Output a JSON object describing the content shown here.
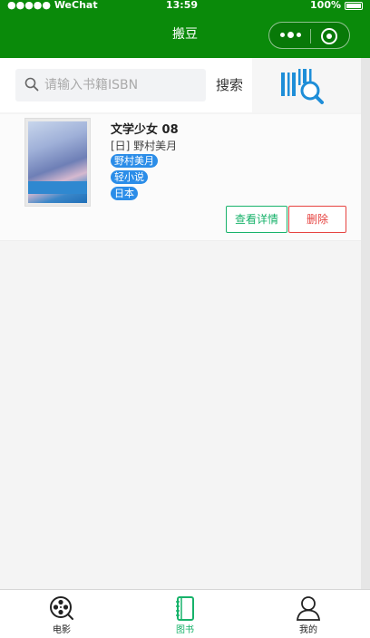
{
  "status_bar": {
    "carrier": "●●●●● WeChat",
    "time": "13:59",
    "battery": "100%"
  },
  "nav": {
    "title": "搬豆"
  },
  "search": {
    "placeholder": "请输入书籍ISBN",
    "value": "",
    "button_label": "搜索"
  },
  "books": [
    {
      "title": "文学少女 08",
      "author": "[日] 野村美月",
      "tags": [
        "野村美月",
        "轻小说",
        "日本"
      ],
      "detail_label": "查看详情",
      "delete_label": "删除"
    }
  ],
  "tabbar": {
    "items": [
      {
        "label": "电影",
        "icon": "film-reel-icon",
        "active": false
      },
      {
        "label": "图书",
        "icon": "notebook-icon",
        "active": true
      },
      {
        "label": "我的",
        "icon": "person-icon",
        "active": false
      }
    ]
  },
  "colors": {
    "header": "#0a8a0a",
    "active_tab": "#17b26a",
    "tag": "#2b8de8",
    "delete": "#e64340",
    "scan_icon": "#1e8ed8"
  }
}
